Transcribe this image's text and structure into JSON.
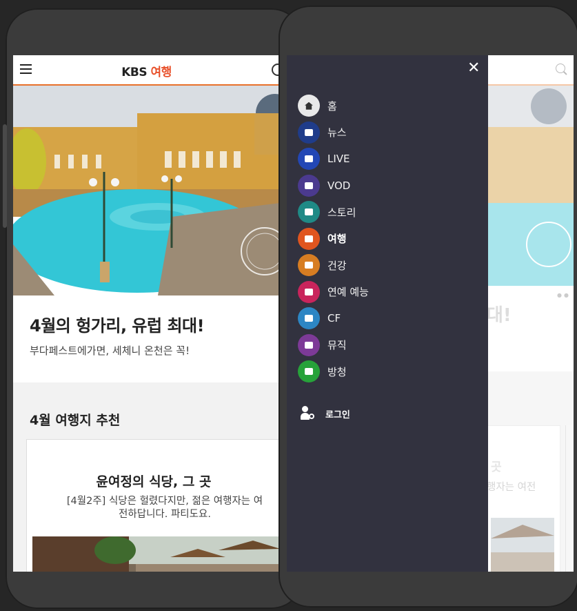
{
  "left_phone": {
    "header": {
      "logo_prefix": "KBS",
      "logo_suffix": "여행"
    },
    "feature": {
      "title": "4월의 헝가리, 유럽 최대!",
      "subtitle": "부다페스트에가면, 세체니 온천은 꼭!"
    },
    "section": {
      "title": "4월 여행지 추천"
    },
    "card": {
      "title": "윤여정의 식당, 그 곳",
      "description_line1": "[4월2주] 식당은 헐렸다지만, 젊은 여행자는 여",
      "description_line2": "전하답니다. 파티도요."
    }
  },
  "right_phone": {
    "background": {
      "title_fragment": "대!",
      "card_title_fragment": "곳",
      "card_desc_fragment": "행자는 여전"
    },
    "drawer": {
      "close_label": "✕",
      "menu": [
        {
          "label": "홈",
          "icon": "home-icon",
          "color": "#e9e9e9"
        },
        {
          "label": "뉴스",
          "icon": "news-icon",
          "color": "#1f3c8a"
        },
        {
          "label": "LIVE",
          "icon": "live-icon",
          "color": "#2347b5"
        },
        {
          "label": "VOD",
          "icon": "vod-icon",
          "color": "#4b3a8f"
        },
        {
          "label": "스토리",
          "icon": "story-icon",
          "color": "#1f8a86"
        },
        {
          "label": "여행",
          "icon": "travel-icon",
          "color": "#e0551f",
          "active": true
        },
        {
          "label": "건강",
          "icon": "health-icon",
          "color": "#d77d22"
        },
        {
          "label": "연예 예능",
          "icon": "entertainment-icon",
          "color": "#c9245c"
        },
        {
          "label": "CF",
          "icon": "cf-icon",
          "color": "#2d86c4"
        },
        {
          "label": "뮤직",
          "icon": "music-icon",
          "color": "#7d3a97"
        },
        {
          "label": "방청",
          "icon": "ticket-icon",
          "color": "#27a23a"
        }
      ],
      "login_label": "로그인"
    }
  },
  "colors": {
    "accent": "#e8702a",
    "drawer_bg": "#32323f",
    "device_frame": "#3b3b3b"
  }
}
